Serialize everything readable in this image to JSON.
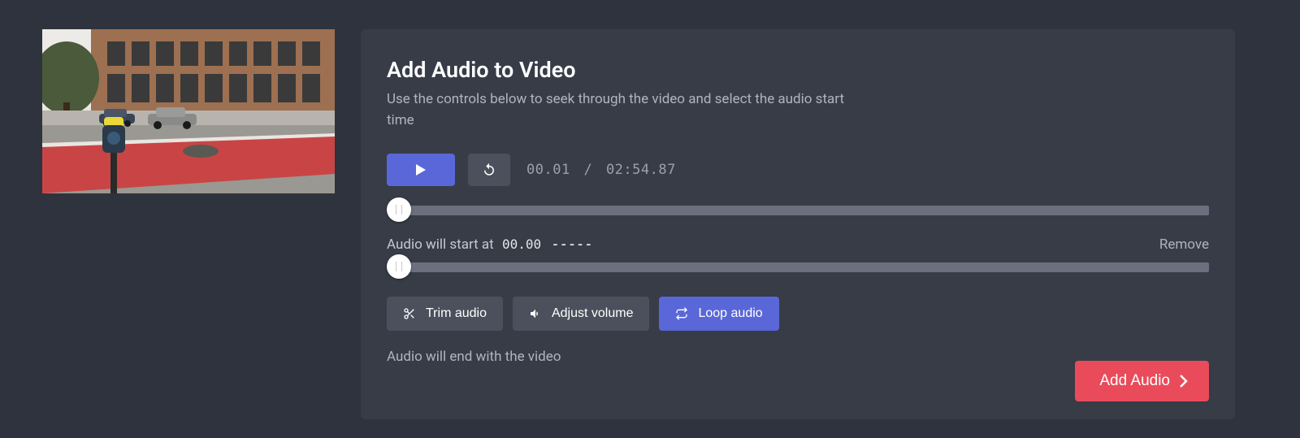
{
  "header": {
    "title": "Add Audio to Video",
    "subtitle": "Use the controls below to seek through the video and select the audio start time"
  },
  "playback": {
    "current": "00.01",
    "separator": "/",
    "total": "02:54.87"
  },
  "audio_start": {
    "label": "Audio will start at",
    "value": "00.00",
    "placeholder": "-----",
    "remove": "Remove"
  },
  "buttons": {
    "trim": "Trim audio",
    "volume": "Adjust volume",
    "loop": "Loop audio"
  },
  "end_note": "Audio will end with the video",
  "add_audio": "Add Audio"
}
